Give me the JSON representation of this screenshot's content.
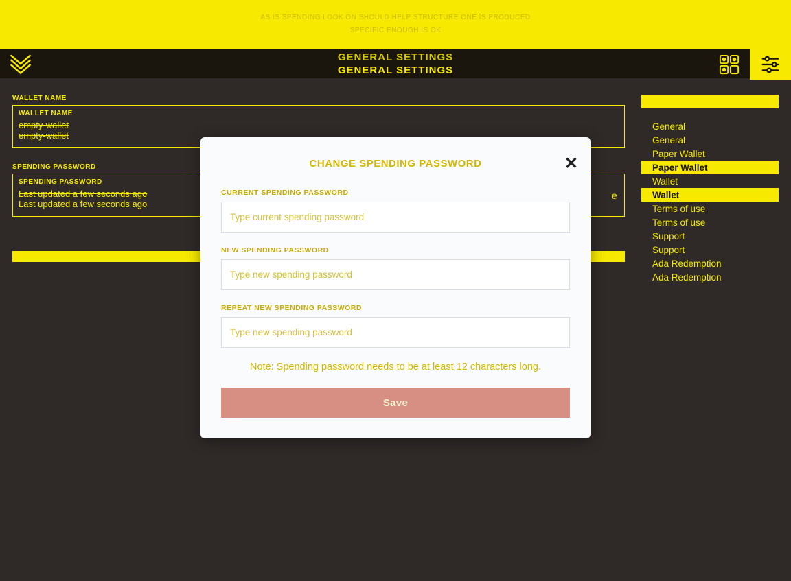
{
  "banner": {
    "line1": "AS IS SPENDING LOOK ON SHOULD HELP STRUCTURE ONE IS PRODUCED",
    "line2": "SPECIFIC ENOUGH IS OK"
  },
  "header": {
    "title_line1": "GENERAL SETTINGS",
    "title_line2": "GENERAL SETTINGS"
  },
  "settings": {
    "wallet_name_label_outer": "WALLET NAME",
    "wallet_name_label_inner": "WALLET NAME",
    "wallet_name_value1": "empty-wallet",
    "wallet_name_value2": "empty-wallet",
    "spending_label_outer": "SPENDING PASSWORD",
    "spending_label_inner": "SPENDING PASSWORD",
    "spending_value1": "Last updated a few seconds ago",
    "spending_value2": "Last updated a few seconds ago",
    "spending_action": "e"
  },
  "nav": {
    "items": [
      {
        "label": "General",
        "stripe": false
      },
      {
        "label": "General",
        "stripe": false
      },
      {
        "label": "Paper Wallet",
        "stripe": false
      },
      {
        "label": "Paper Wallet",
        "stripe": true
      },
      {
        "label": "Wallet",
        "stripe": false
      },
      {
        "label": "Wallet",
        "stripe": true
      },
      {
        "label": "Terms of use",
        "stripe": false
      },
      {
        "label": "Terms of use",
        "stripe": false
      },
      {
        "label": "Support",
        "stripe": false
      },
      {
        "label": "Support",
        "stripe": false
      },
      {
        "label": "Ada Redemption",
        "stripe": false
      },
      {
        "label": "Ada Redemption",
        "stripe": false
      }
    ]
  },
  "modal": {
    "title": "CHANGE SPENDING PASSWORD",
    "current_label": "CURRENT SPENDING PASSWORD",
    "current_placeholder": "Type current spending password",
    "new_label": "NEW SPENDING PASSWORD",
    "new_placeholder": "Type new spending password",
    "repeat_label": "REPEAT NEW SPENDING PASSWORD",
    "repeat_placeholder": "Type new spending password",
    "note": "Note: Spending password needs to be at least 12 characters long.",
    "save": "Save"
  }
}
